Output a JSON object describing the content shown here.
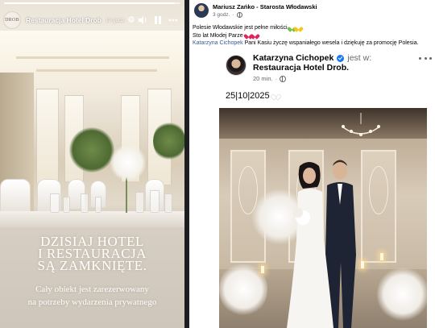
{
  "story": {
    "logo_text": "DROB",
    "page_name": "Restauracja Hotel Drob",
    "time": "10 godz.",
    "progress": 0.97,
    "headline": [
      "DZISIAJ HOTEL",
      "I RESTAURACJA",
      "SĄ ZAMKNIĘTE."
    ],
    "subline": [
      "Cały obiekt  jest zarezerwowany",
      "na potrzeby wydarzenia prywatnego"
    ],
    "controls": [
      "speaker-icon",
      "pause-icon",
      "more-icon"
    ]
  },
  "post": {
    "author": "Mariusz Zańko - Starosta Włodawski",
    "time": "3 godz.",
    "line1": "Polesie Włodawskie jest pełne miłości",
    "line2": "Sto lat Młodej Parze",
    "mention": "Katarzyna Cichopek",
    "line3_rest": " Pani Kasiu życzę wspaniałego wesela i dziękuję za promocję Polesia.",
    "shared": {
      "name": "Katarzyna Cichopek",
      "is_at": "jest w:",
      "place": "Restauracja Hotel Drob",
      "place_suffix": ".",
      "time": "20 min.",
      "date_text": "25|10|2025"
    }
  },
  "colors": {
    "link": "#385898",
    "verified": "#1877f2",
    "secondary_text": "#65676b",
    "divider": "#1c1e21"
  }
}
